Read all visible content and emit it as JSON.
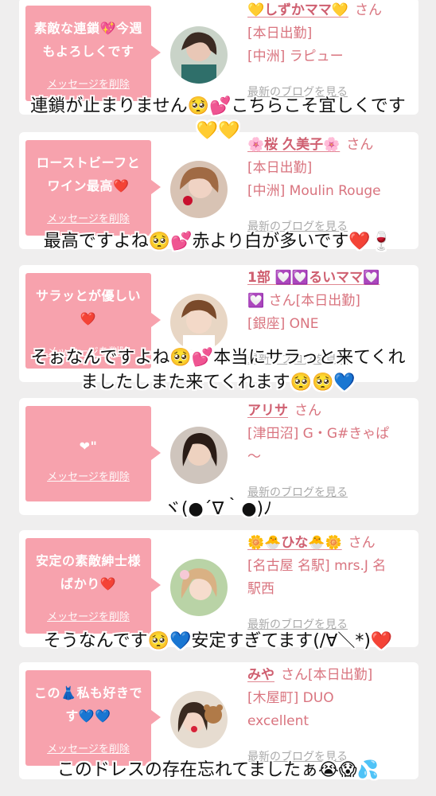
{
  "delete_label": "メッセージを削除",
  "blog_label": "最新のブログを見る",
  "san": "さん",
  "cards": [
    {
      "bubble": "素敵な連鎖💖今週\nもよろしくです",
      "name": "💛しずかママ💛",
      "line1": "[本日出勤]",
      "line2": "[中洲] ラピュー"
    },
    {
      "bubble": "ローストビーフと\nワイン最高❤️",
      "name": "🌸桜 久美子🌸",
      "line1": "[本日出勤]",
      "line2": "[中洲] Moulin Rouge"
    },
    {
      "bubble": "サラッとが優しい\n❤️",
      "name": "1部 💟💟るいママ💟",
      "name_cont": "💟",
      "line1": "さん[本日出勤]",
      "line2": "[銀座] ONE"
    },
    {
      "bubble": "❤\"",
      "name": "アリサ",
      "line1": "[津田沼] G・G#きゃぱ",
      "line2": "〜"
    },
    {
      "bubble": "安定の素敵紳士様\nばかり❤️",
      "name": "🌼🐣ひな🐣🌼",
      "line1": "[名古屋 名駅] mrs.J 名",
      "line2": "駅西"
    },
    {
      "bubble": "この👗私も好きで\nす💙💙",
      "name": "みや",
      "name_suffix": "さん[本日出勤]",
      "line1": "[木屋町] DUO",
      "line2": "excellent"
    }
  ],
  "overlays": [
    "連鎖が止まりません🥺💕こちらこそ宜しくです\n💛💛",
    "最高ですよね🥺💕赤より白が多いです❤️🍷",
    "そぉなんですよね🥺💕本当にサラっと来てくれ\nましたしまた来てくれます🥺🥺💙",
    "ヾ(●´∇｀●)ﾉ",
    "そうなんです🥺💙安定すぎてます(/∀＼*)❤️",
    "このドレスの存在忘れてましたぁ😭😱💦"
  ]
}
